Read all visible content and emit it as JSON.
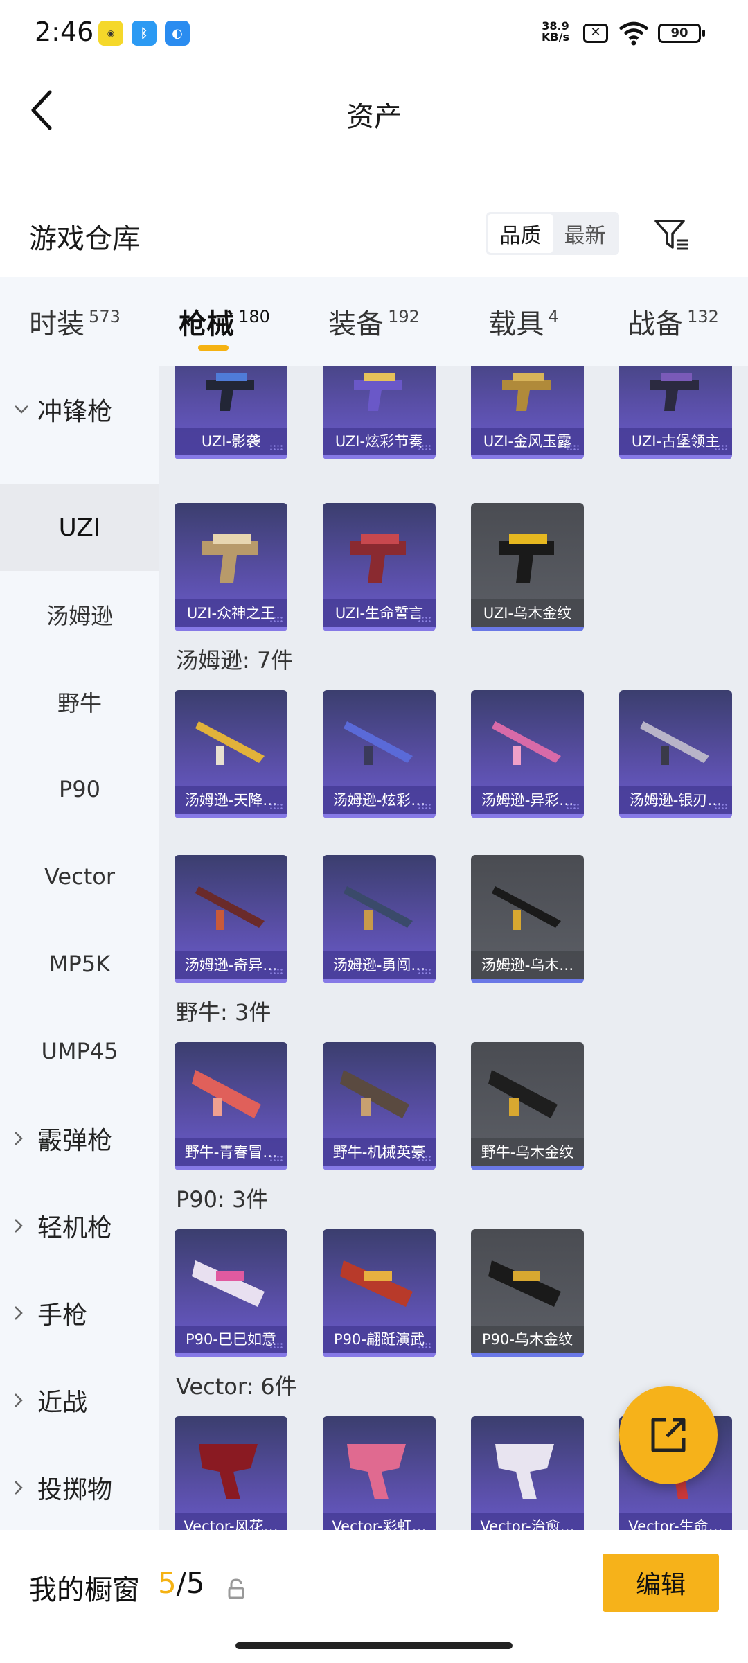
{
  "status_bar": {
    "time": "2:46",
    "net_speed_value": "38.9",
    "net_speed_unit": "KB/s",
    "battery": "90",
    "app_icons": [
      "game-app-icon",
      "bluetooth-icon",
      "message-app-icon"
    ]
  },
  "header": {
    "title": "资产"
  },
  "warehouse": {
    "title": "游戏仓库",
    "sort_options": [
      "品质",
      "最新"
    ],
    "sort_selected": "品质"
  },
  "tabs": [
    {
      "label": "时装",
      "count": "573"
    },
    {
      "label": "枪械",
      "count": "180",
      "active": true
    },
    {
      "label": "装备",
      "count": "192"
    },
    {
      "label": "载具",
      "count": "4"
    },
    {
      "label": "战备",
      "count": "132"
    }
  ],
  "left_nav": {
    "expanded_group": "冲锋枪",
    "sub_items": [
      "UZI",
      "汤姆逊",
      "野牛",
      "P90",
      "Vector",
      "MP5K",
      "UMP45"
    ],
    "active_sub_item": "UZI",
    "collapsed_groups": [
      "霰弹枪",
      "轻机枪",
      "手枪",
      "近战",
      "投掷物"
    ]
  },
  "content": {
    "uzi_partial_row": [
      "UZI-影袭",
      "UZI-炫彩节奏",
      "UZI-金风玉露",
      "UZI-古堡领主"
    ],
    "uzi_row2": [
      "UZI-众神之王",
      "UZI-生命誓言",
      "UZI-乌木金纹"
    ],
    "sections": [
      {
        "title": "汤姆逊: 7件",
        "items": [
          "汤姆逊-天降…",
          "汤姆逊-炫彩…",
          "汤姆逊-异彩…",
          "汤姆逊-银刃…",
          "汤姆逊-奇异…",
          "汤姆逊-勇闯…",
          "汤姆逊-乌木…"
        ]
      },
      {
        "title": "野牛: 3件",
        "items": [
          "野牛-青春冒…",
          "野牛-机械英豪",
          "野牛-乌木金纹"
        ]
      },
      {
        "title": "P90: 3件",
        "items": [
          "P90-巳巳如意",
          "P90-翩跹演武",
          "P90-乌木金纹"
        ]
      },
      {
        "title": "Vector: 6件",
        "items": [
          "Vector-风花…",
          "Vector-彩虹…",
          "Vector-治愈…",
          "Vector-生命…"
        ]
      }
    ]
  },
  "bottom_bar": {
    "label": "我的橱窗",
    "current": "5",
    "total": "/5",
    "edit_label": "编辑"
  },
  "colors": {
    "accent": "#f6b21a",
    "card_purple": "#5a4fa8",
    "card_black": "#55585e"
  }
}
